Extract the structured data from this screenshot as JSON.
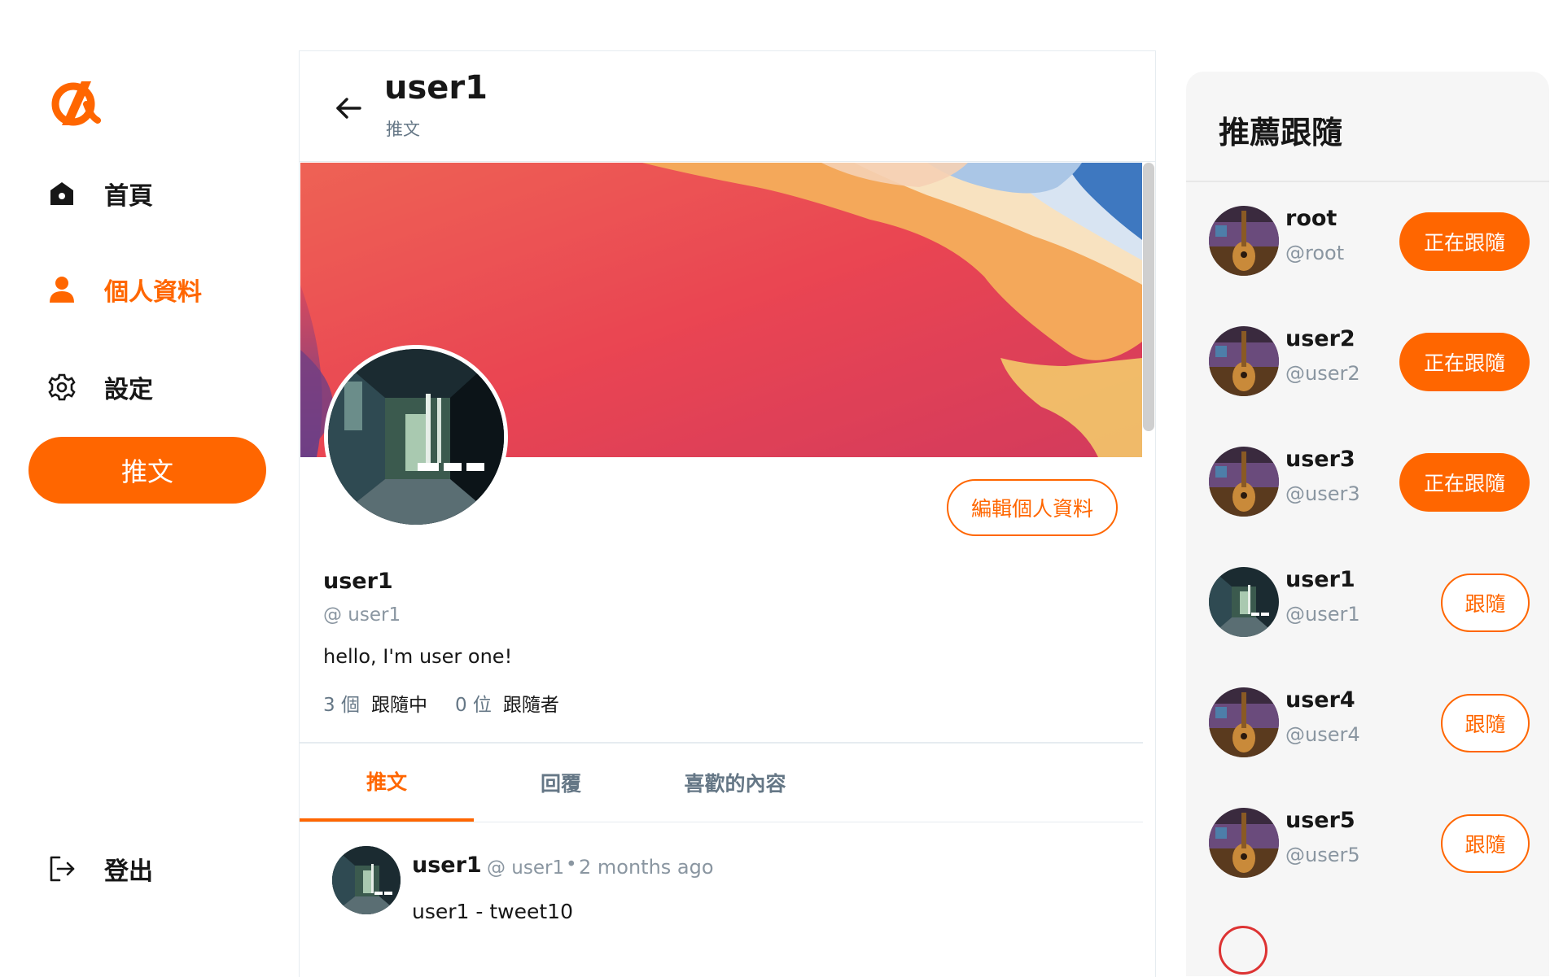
{
  "nav": {
    "items": [
      {
        "label": "首頁",
        "icon": "home-icon"
      },
      {
        "label": "個人資料",
        "icon": "user-icon"
      },
      {
        "label": "設定",
        "icon": "gear-icon"
      }
    ],
    "tweet_button": "推文",
    "logout_label": "登出"
  },
  "header": {
    "title": "user1",
    "subtitle": "推文"
  },
  "profile": {
    "name": "user1",
    "handle": "@ user1",
    "bio": "hello, I'm user one!",
    "edit_button": "編輯個人資料",
    "following_count": "3 個",
    "following_label": "跟隨中",
    "followers_count": "0 位",
    "followers_label": "跟隨者"
  },
  "tabs": [
    {
      "label": "推文"
    },
    {
      "label": "回覆"
    },
    {
      "label": "喜歡的內容"
    }
  ],
  "tweet": {
    "name": "user1",
    "handle": "@ user1",
    "dot": "•",
    "time": "2 months ago",
    "text": "user1 - tweet10"
  },
  "suggestions": {
    "title": "推薦跟隨",
    "users": [
      {
        "name": "root",
        "handle": "@root",
        "button": "正在跟隨"
      },
      {
        "name": "user2",
        "handle": "@user2",
        "button": "正在跟隨"
      },
      {
        "name": "user3",
        "handle": "@user3",
        "button": "正在跟隨"
      },
      {
        "name": "user1",
        "handle": "@user1",
        "button": "跟隨"
      },
      {
        "name": "user4",
        "handle": "@user4",
        "button": "跟隨"
      },
      {
        "name": "user5",
        "handle": "@user5",
        "button": "跟隨"
      }
    ]
  },
  "colors": {
    "accent": "#ff6600",
    "muted": "#8a96a1",
    "panel": "#f6f6f6"
  }
}
